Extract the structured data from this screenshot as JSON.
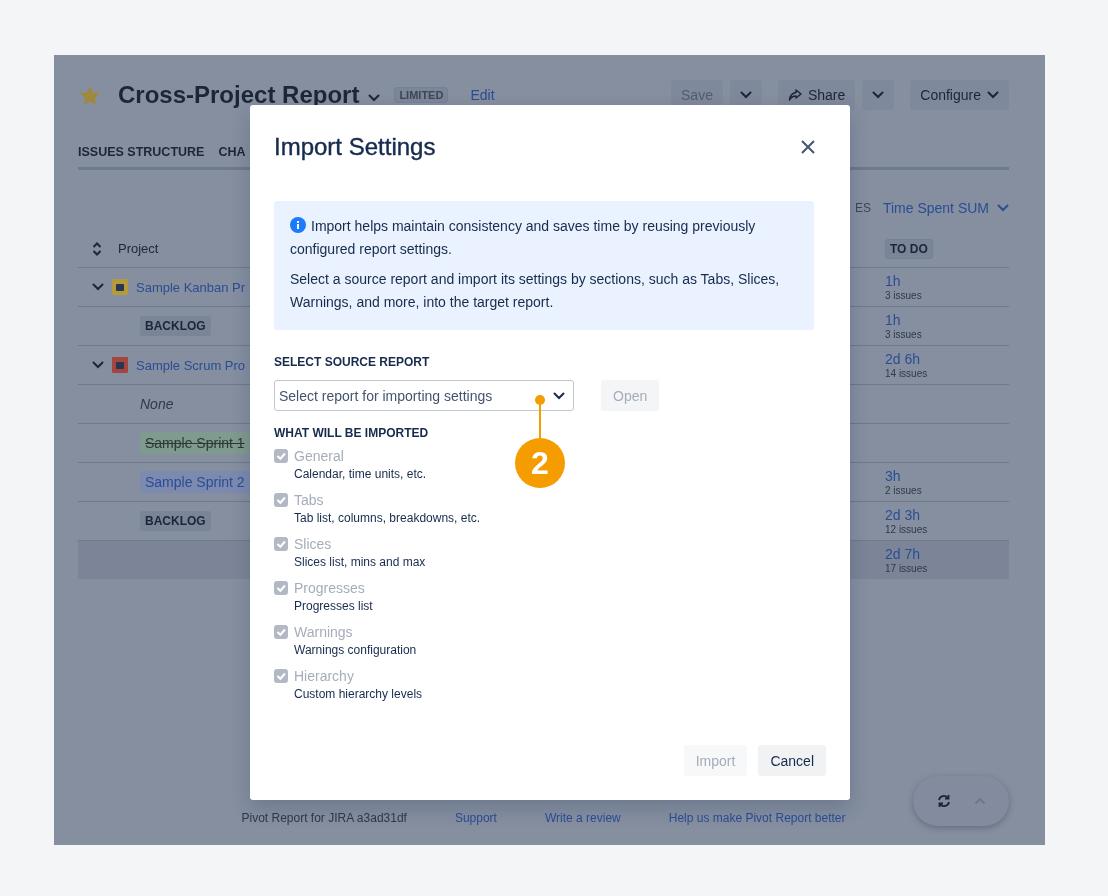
{
  "report": {
    "title": "Cross-Project Report",
    "starred": true,
    "badge": "LIMITED",
    "edit_link": "Edit",
    "buttons": [
      {
        "label": "Save",
        "kind": "split",
        "disabled": true
      },
      {
        "label": "Share",
        "kind": "split",
        "disabled": false
      },
      {
        "label": "Configure",
        "kind": "menu",
        "disabled": false
      }
    ],
    "tabs": [
      {
        "label": "ISSUES STRUCTURE"
      },
      {
        "label": "CHA"
      }
    ],
    "columns_label": "ES",
    "measure": "Time Spent SUM",
    "table": {
      "column_1": "Project",
      "column_2": "TO DO",
      "rows": [
        {
          "kind": "project",
          "label": "Sample Kanban Pr",
          "expanded": true,
          "color": "#b39a3c",
          "time": "1h",
          "issues": "3 issues"
        },
        {
          "kind": "backlog",
          "label": "BACKLOG",
          "time": "1h",
          "issues": "3 issues"
        },
        {
          "kind": "project",
          "label": "Sample Scrum Pro",
          "expanded": true,
          "color": "#a4463f",
          "time": "2d 6h",
          "issues": "14 issues"
        },
        {
          "kind": "none",
          "label": "None"
        },
        {
          "kind": "sprint",
          "label": "Sample Sprint 1",
          "closed": true
        },
        {
          "kind": "sprint",
          "label": "Sample Sprint 2",
          "closed": false,
          "time": "3h",
          "issues": "2 issues"
        },
        {
          "kind": "backlog",
          "label": "BACKLOG",
          "time": "2d 3h",
          "issues": "12 issues"
        },
        {
          "kind": "total",
          "time": "2d 7h",
          "issues": "17 issues"
        }
      ]
    }
  },
  "footer": {
    "text": "Pivot Report for JIRA a3ad31df",
    "links": [
      "Support",
      "Write a review",
      "Help us make Pivot Report better"
    ]
  },
  "dialog": {
    "title": "Import Settings",
    "info": [
      "Import helps maintain consistency and saves time by reusing previously configured report settings.",
      "Select a source report and import its settings by sections, such as Tabs, Slices, Warnings, and more, into the target report."
    ],
    "source_label": "SELECT SOURCE REPORT",
    "source_select": {
      "placeholder": "Select report for importing settings"
    },
    "open_button": {
      "label": "Open",
      "disabled": true
    },
    "sections_label": "WHAT WILL BE IMPORTED",
    "sections": [
      {
        "label": "General",
        "description": "Calendar, time units, etc.",
        "checked": true,
        "disabled": true
      },
      {
        "label": "Tabs",
        "description": "Tab list, columns, breakdowns, etc.",
        "checked": true,
        "disabled": true
      },
      {
        "label": "Slices",
        "description": "Slices list, mins and max",
        "checked": true,
        "disabled": true
      },
      {
        "label": "Progresses",
        "description": "Progresses list",
        "checked": true,
        "disabled": true
      },
      {
        "label": "Warnings",
        "description": "Warnings configuration",
        "checked": true,
        "disabled": true
      },
      {
        "label": "Hierarchy",
        "description": "Custom hierarchy levels",
        "checked": true,
        "disabled": true
      }
    ],
    "actions": [
      {
        "label": "Import",
        "disabled": true
      },
      {
        "label": "Cancel",
        "disabled": false
      }
    ],
    "callout": "2"
  }
}
